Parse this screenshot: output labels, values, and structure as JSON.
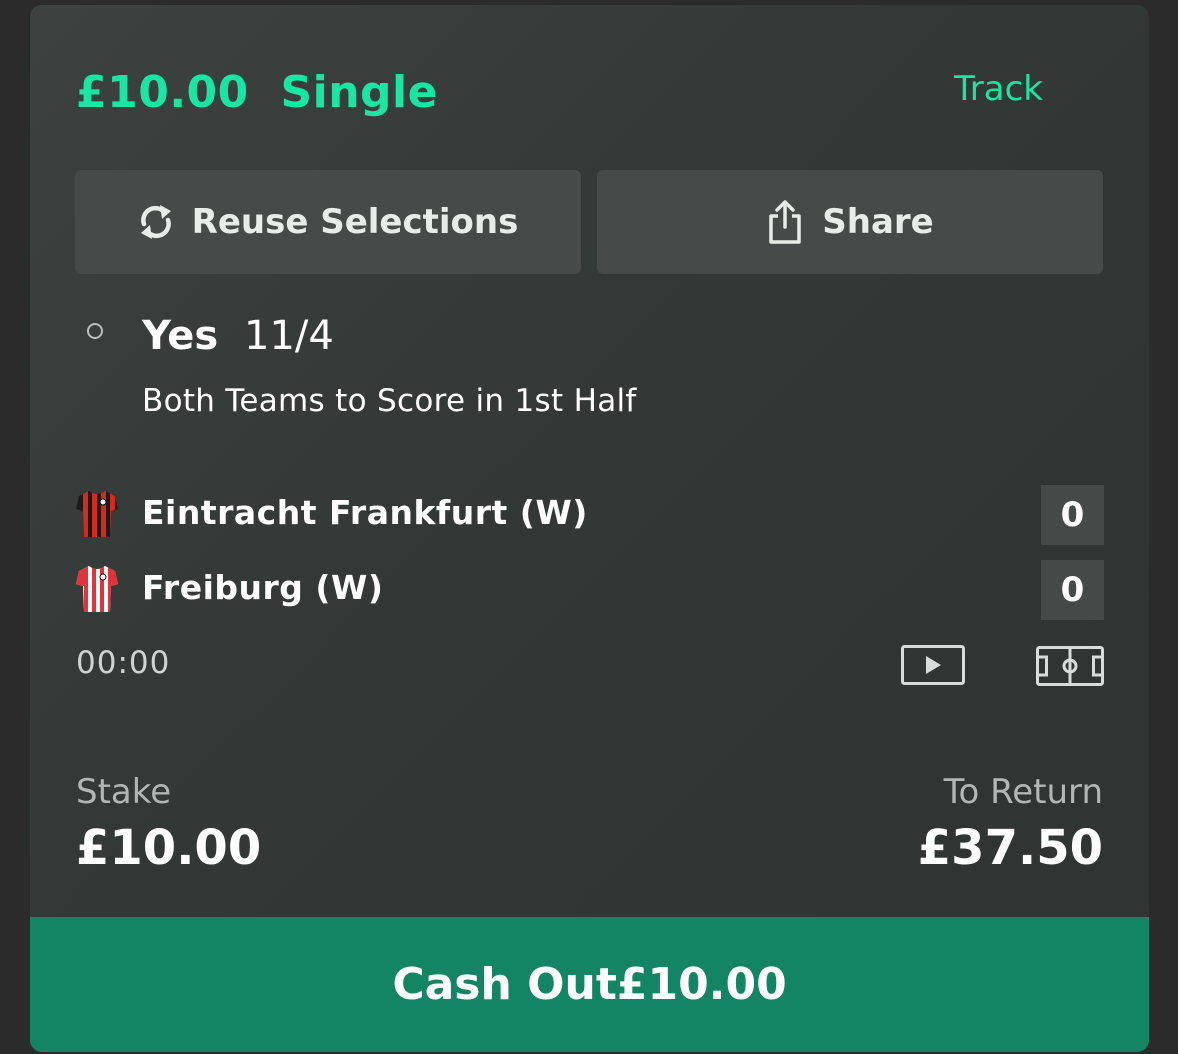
{
  "bet": {
    "amount": "£10.00",
    "type": "Single",
    "track_label": "Track"
  },
  "actions": {
    "reuse_label": "Reuse Selections",
    "share_label": "Share"
  },
  "selection": {
    "name": "Yes",
    "odds": "11/4",
    "market": "Both Teams to Score in 1st Half"
  },
  "match": {
    "home": {
      "name": "Eintracht Frankfurt (W)",
      "score": "0",
      "kit": "red-black-striped-shirt"
    },
    "away": {
      "name": "Freiburg (W)",
      "score": "0",
      "kit": "red-white-striped-shirt"
    },
    "clock": "00:00",
    "icons": [
      "play-stream-icon",
      "pitch-icon"
    ]
  },
  "summary": {
    "stake_label": "Stake",
    "stake_value": "£10.00",
    "return_label": "To Return",
    "return_value": "£37.50"
  },
  "cashout": {
    "label": "Cash Out",
    "amount": "£10.00"
  },
  "colors": {
    "accent": "#19e6a2",
    "cashout_bg": "#138562",
    "card_bg": "#363b39",
    "button_bg": "#464b49"
  }
}
